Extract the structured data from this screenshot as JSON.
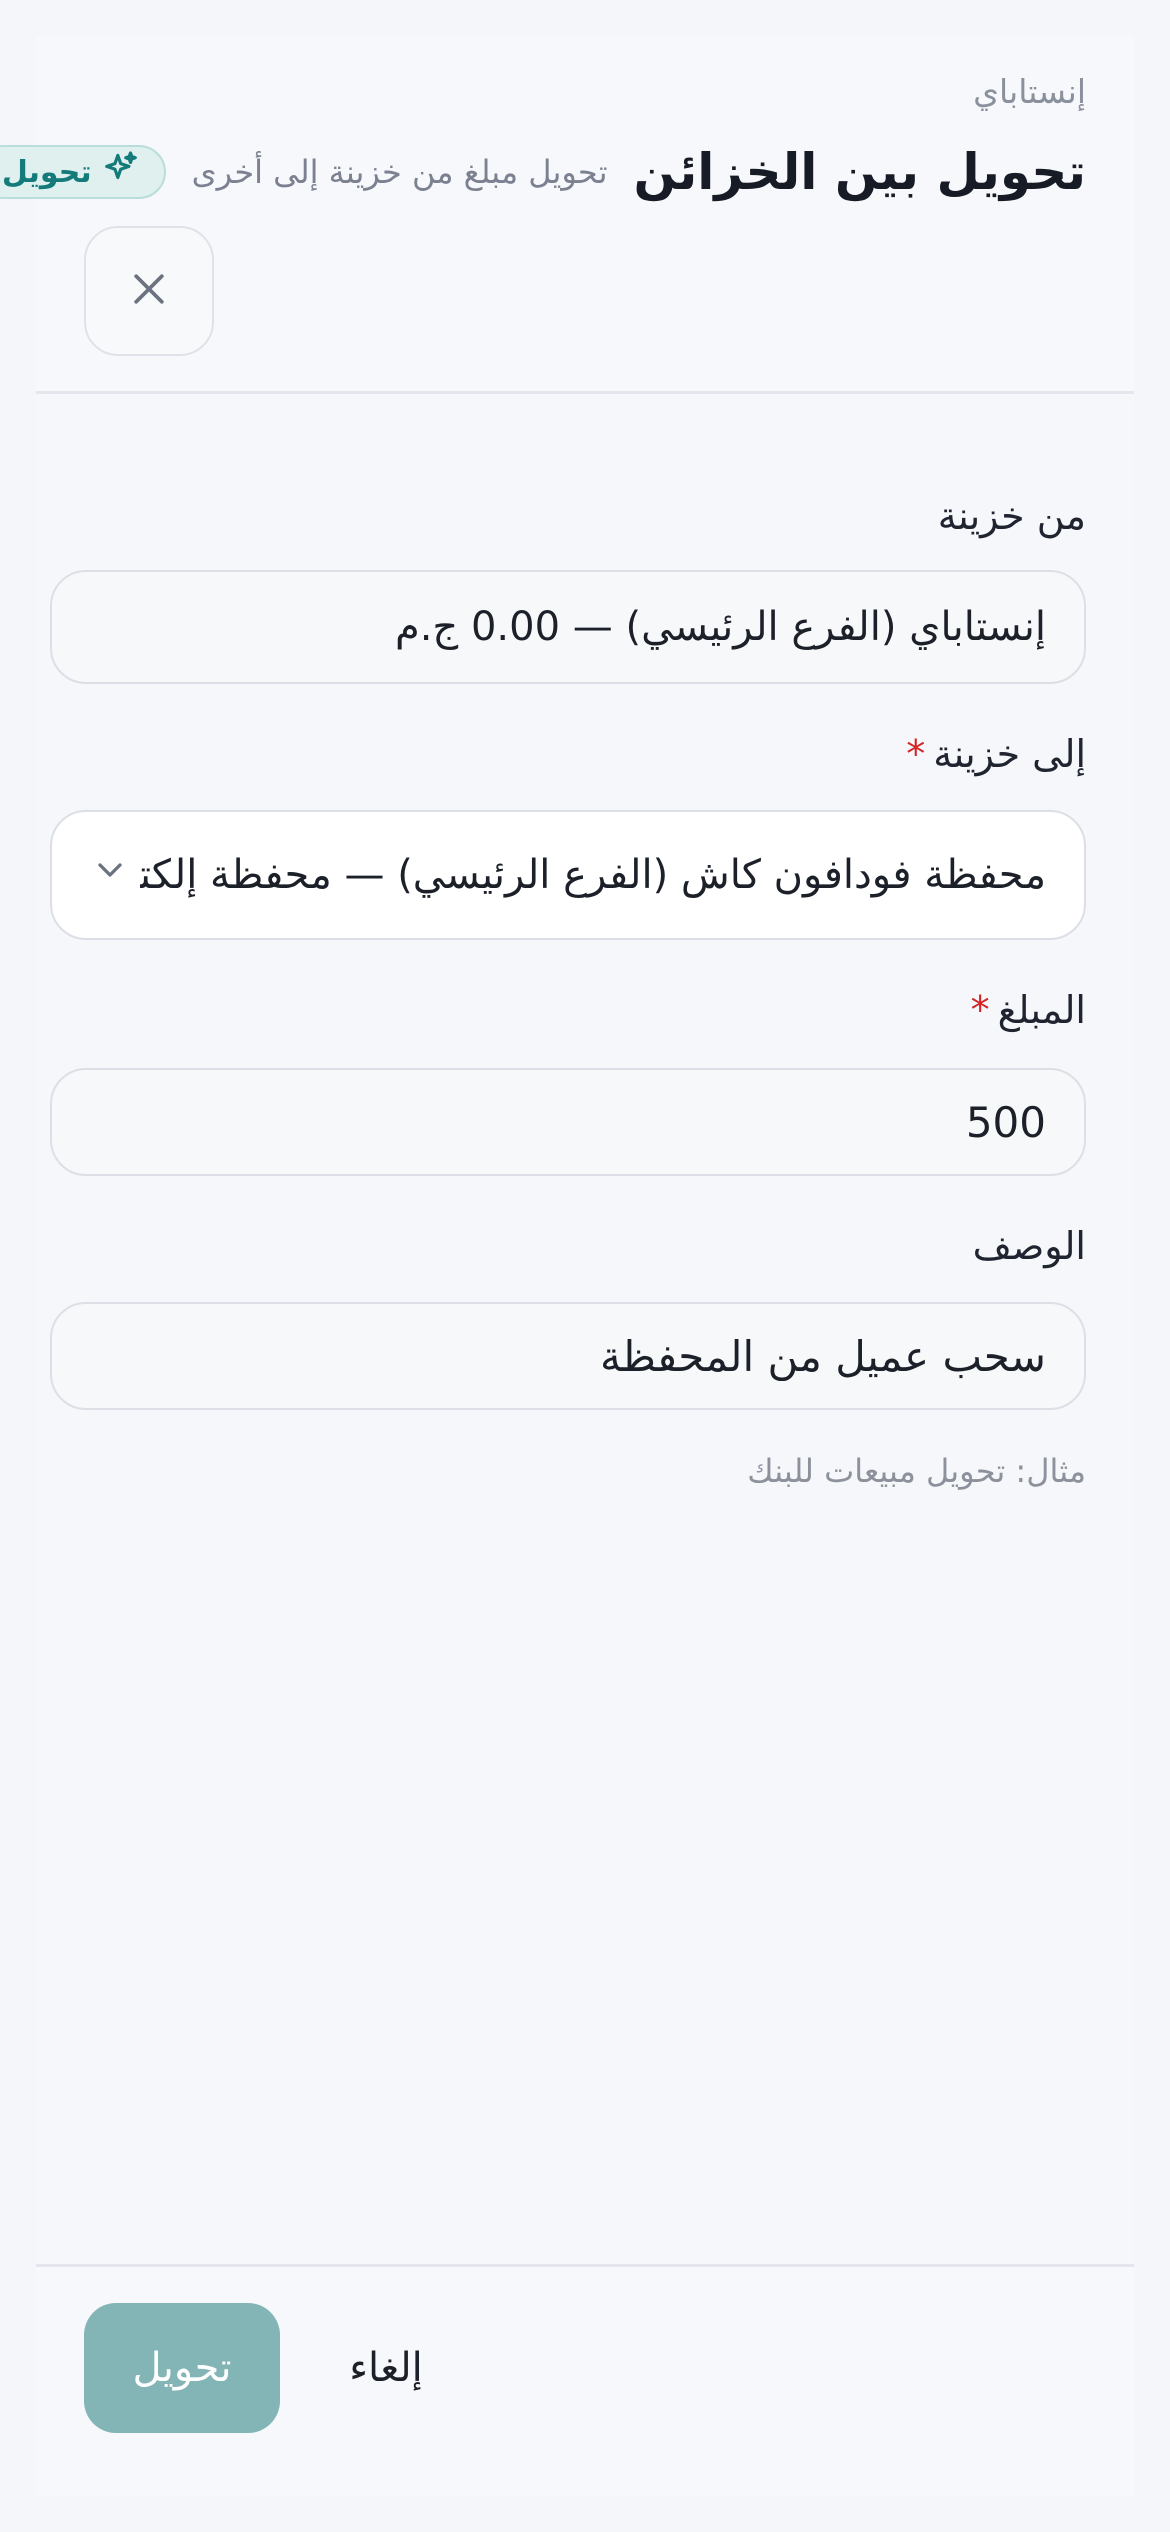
{
  "header": {
    "brand": "إنستاباي",
    "title": "تحويل بين الخزائن",
    "subtitle": "تحويل مبلغ من خزينة إلى أخرى",
    "badge_label": "تحويل",
    "badge_icon": "sparkles-icon",
    "close_icon": "close-icon"
  },
  "form": {
    "from_label": "من خزينة",
    "from_value": "إنستاباي (الفرع الرئيسي) — 0.00 ج.م",
    "to_label": "إلى خزينة",
    "to_required": "*",
    "to_value": "محفظة فودافون كاش (الفرع الرئيسي) — محفظة إلكترونية",
    "to_icon": "chevron-down-icon",
    "amount_label": "المبلغ",
    "amount_required": "*",
    "amount_value": "500",
    "desc_label": "الوصف",
    "desc_value": "سحب عميل من المحفظة",
    "desc_hint": "مثال: تحويل مبيعات للبنك"
  },
  "footer": {
    "submit_label": "تحويل",
    "cancel_label": "إلغاء"
  },
  "colors": {
    "accent": "#147a7a",
    "submit_bg": "#83b5b7",
    "required": "#d32525"
  }
}
